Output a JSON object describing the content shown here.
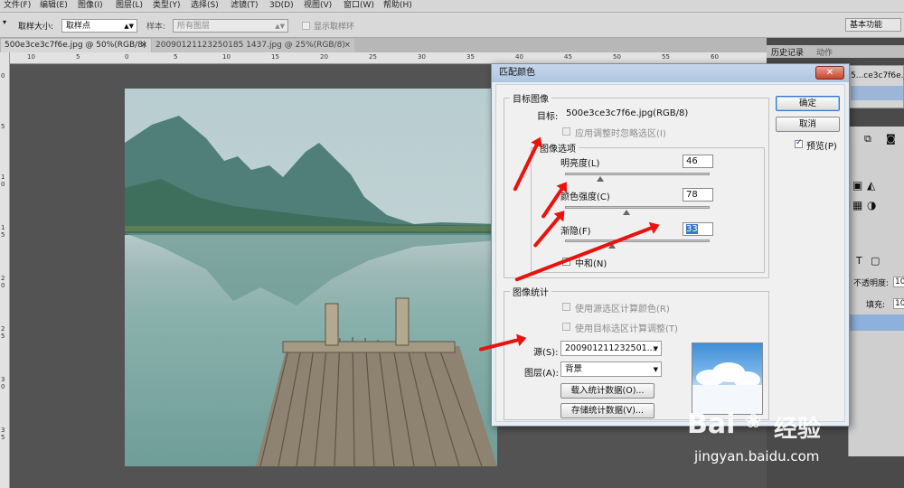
{
  "menubar": {
    "items": [
      "文件(F)",
      "编辑(E)",
      "图像(I)",
      "图层(L)",
      "类型(Y)",
      "选择(S)",
      "滤镜(T)",
      "3D(D)",
      "视图(V)",
      "窗口(W)",
      "帮助(H)"
    ]
  },
  "options": {
    "sample_size_label": "取样大小:",
    "sample_size_value": "取样点",
    "sample_label": "样本:",
    "sample_value": "所有图层",
    "show_ring_label": "显示取样环",
    "workspace": "基本功能"
  },
  "tabs": [
    {
      "label": "500e3ce3c7f6e.jpg @ 50%(RGB/8)",
      "close": "×"
    },
    {
      "label": "20090121123250185 1437.jpg @ 25%(RGB/8)",
      "close": "×"
    }
  ],
  "ruler_h": [
    "10",
    "5",
    "0",
    "5",
    "10",
    "15",
    "20",
    "25",
    "30",
    "35",
    "40",
    "45",
    "50",
    "55",
    "60"
  ],
  "ruler_v": [
    "0",
    "5",
    "1 0",
    "1 5",
    "2 0",
    "2 5",
    "3 0",
    "3 5"
  ],
  "panels": {
    "history_tab": "历史记录",
    "actions_tab": "动作",
    "history_file": "5...ce3c7f6e.jpg",
    "opacity_label": "不透明度:",
    "opacity_value": "100",
    "fill_label": "填充:",
    "fill_value": "100"
  },
  "dialog": {
    "title": "匹配颜色",
    "close": "✕",
    "target_group": "目标图像",
    "target_label": "目标:",
    "target_value": "500e3ce3c7f6e.jpg(RGB/8)",
    "ignore_selection": "应用调整时忽略选区(I)",
    "image_options_group": "图像选项",
    "luminance_label": "明亮度(L)",
    "luminance_value": "46",
    "color_intensity_label": "颜色强度(C)",
    "color_intensity_value": "78",
    "fade_label": "渐隐(F)",
    "fade_value": "33",
    "neutralize_label": "中和(N)",
    "stats_group": "图像统计",
    "use_source_selection": "使用源选区计算颜色(R)",
    "use_target_selection": "使用目标选区计算调整(T)",
    "source_label": "源(S):",
    "source_value": "200901211232501...",
    "layer_label": "图层(A):",
    "layer_value": "背景",
    "load_stats": "载入统计数据(O)...",
    "save_stats": "存储统计数据(V)...",
    "ok": "确定",
    "cancel": "取消",
    "preview": "预览(P)"
  },
  "sliders": {
    "luminance": 46,
    "color_intensity": 78,
    "fade": 33
  },
  "watermark": {
    "brand": "Bai",
    "brand2": "经验",
    "url": "jingyan.baidu.com"
  },
  "colors": {
    "arrow": "#e8130e",
    "dialog_title": "#b9cde6",
    "selection": "#3578c8"
  }
}
